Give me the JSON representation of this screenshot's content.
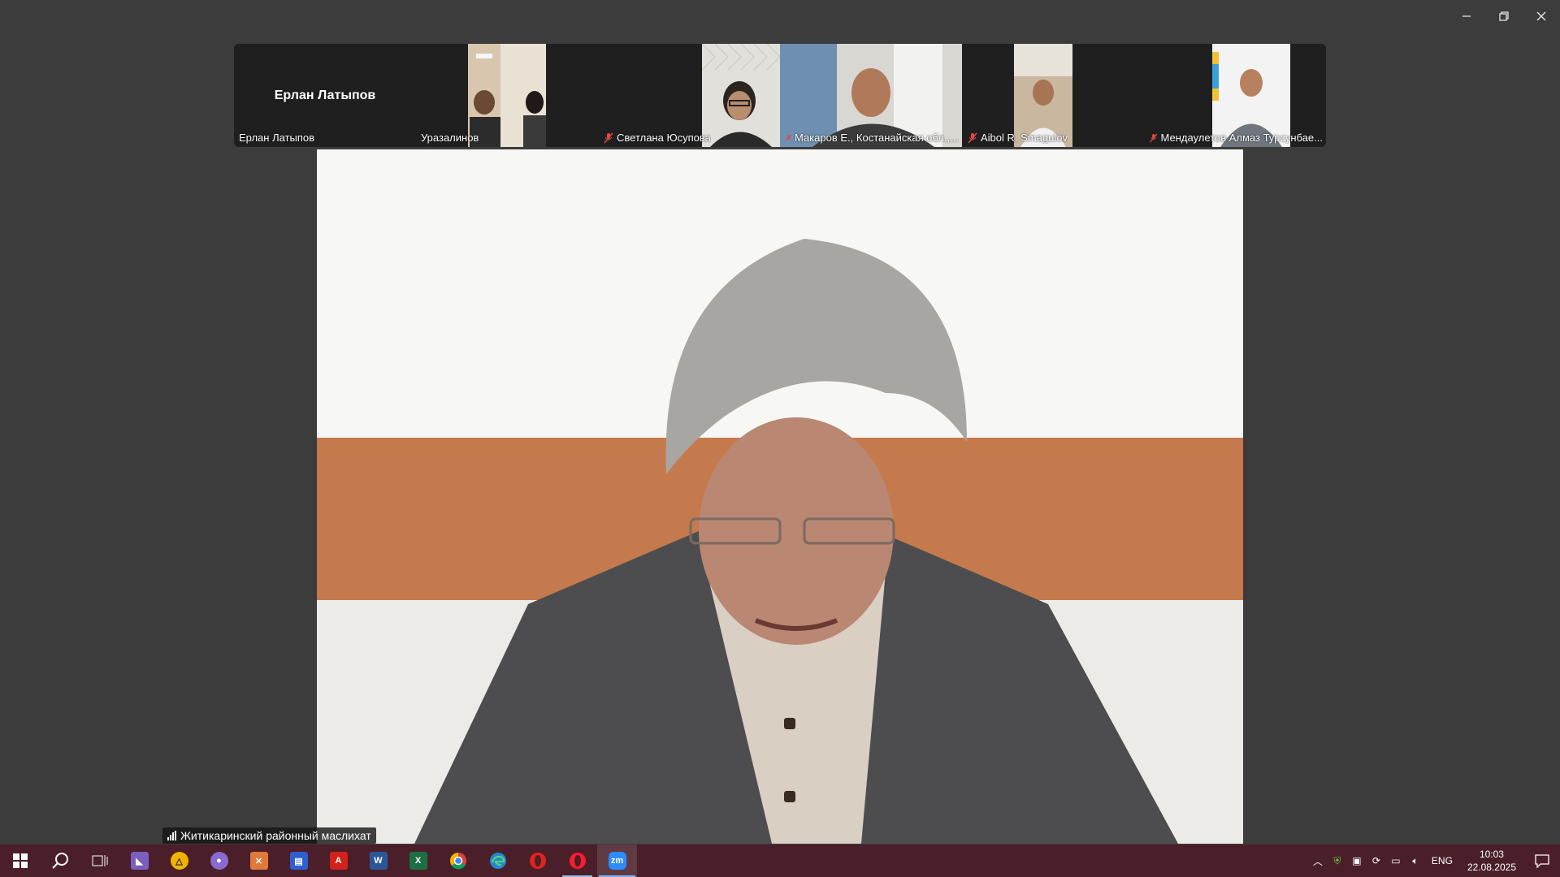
{
  "window": {
    "controls": {
      "minimize": "minimize-icon",
      "restore": "restore-icon",
      "close": "close-icon"
    }
  },
  "gallery": {
    "tiles": [
      {
        "name": "Ерлан Латыпов",
        "video": false,
        "muted": false,
        "display_name": "Ерлан Латыпов"
      },
      {
        "name": "Уразалинов",
        "video": true,
        "muted": false
      },
      {
        "name": "Светлана Юсупова",
        "video": true,
        "muted": true
      },
      {
        "name": "Макаров Е., Костанайская обл.,...",
        "video": true,
        "muted": true
      },
      {
        "name": "Aibol R. Smagulov",
        "video": true,
        "muted": true
      },
      {
        "name": "Мендаулетов Алмаз Турсунбае...",
        "video": true,
        "muted": true
      }
    ]
  },
  "main": {
    "speaker_label": "Житикаринский районный маслихат"
  },
  "taskbar": {
    "apps": [
      "start-icon",
      "search-icon",
      "task-view-icon",
      "visual-studio-icon",
      "archicad-icon",
      "media-icon",
      "tools-icon",
      "save-icon",
      "acrobat-icon",
      "word-icon",
      "excel-icon",
      "chrome-icon",
      "edge-icon",
      "opera-icon",
      "opera-gx-icon",
      "zoom-icon"
    ],
    "language": "ENG",
    "time": "10:03",
    "date": "22.08.2025",
    "accent": "#4a1f2a"
  }
}
